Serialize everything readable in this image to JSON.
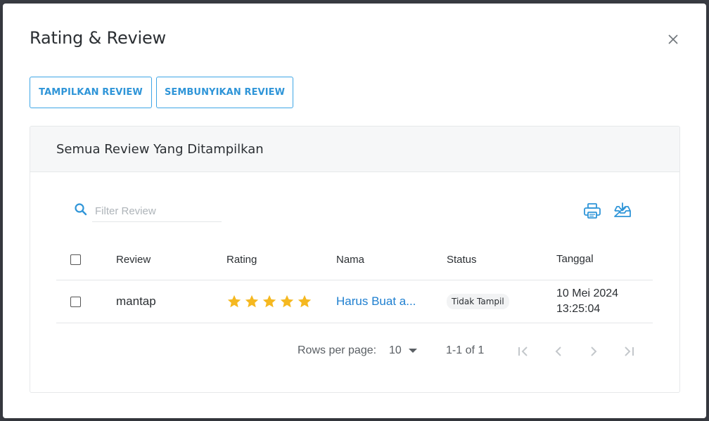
{
  "modal": {
    "title": "Rating & Review",
    "close_icon": "close-icon"
  },
  "actions": {
    "show_label": "TAMPILKAN REVIEW",
    "hide_label": "SEMBUNYIKAN REVIEW"
  },
  "card": {
    "title": "Semua Review Yang Ditampilkan"
  },
  "search": {
    "placeholder": "Filter Review",
    "value": ""
  },
  "toolbar": {
    "print_icon": "printer-icon",
    "export_icon": "download-tray-icon"
  },
  "table": {
    "headers": {
      "review": "Review",
      "rating": "Rating",
      "nama": "Nama",
      "status": "Status",
      "tanggal": "Tanggal"
    },
    "rows": [
      {
        "review": "mantap",
        "rating": 5,
        "nama": "Harus Buat a...",
        "status": "Tidak Tampil",
        "tanggal": "10 Mei 2024\n13:25:04"
      }
    ]
  },
  "pagination": {
    "rows_per_page_label": "Rows per page:",
    "rows_per_page": "10",
    "range": "1-1 of 1"
  },
  "colors": {
    "accent": "#2f95d8",
    "star": "#f5b820",
    "link": "#1e7fd0"
  }
}
